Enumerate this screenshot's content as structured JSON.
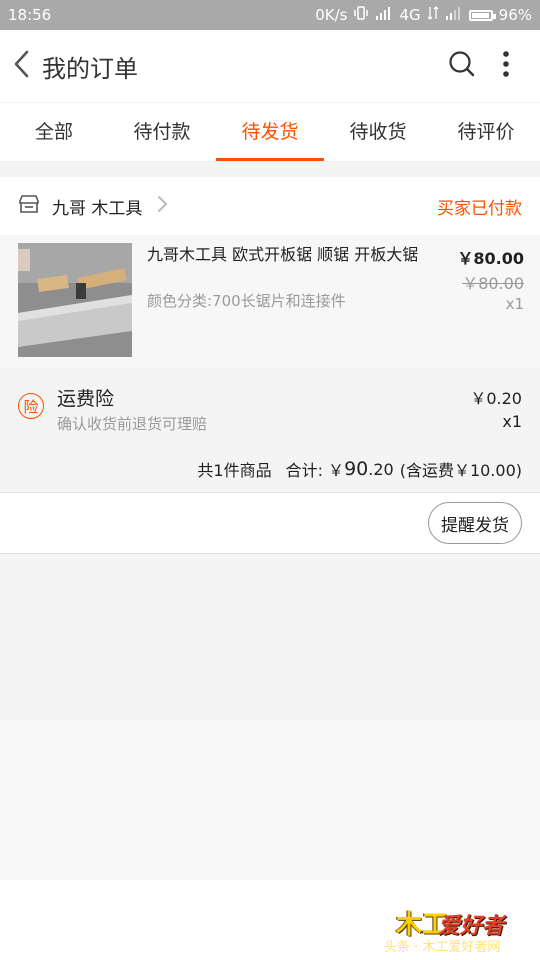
{
  "status_bar": {
    "time": "18:56",
    "net_speed": "0K/s",
    "network": "4G",
    "battery": "96%",
    "battery_level": 0.96
  },
  "header": {
    "title": "我的订单",
    "back_icon": "chevron-left-icon",
    "search_icon": "search-icon",
    "more_icon": "more-vertical-icon"
  },
  "tabs": [
    {
      "label": "全部",
      "active": false
    },
    {
      "label": "待付款",
      "active": false
    },
    {
      "label": "待发货",
      "active": true
    },
    {
      "label": "待收货",
      "active": false
    },
    {
      "label": "待评价",
      "active": false
    }
  ],
  "order": {
    "shop_name": "九哥 木工具",
    "status": "买家已付款",
    "product": {
      "name": "九哥木工具 欧式开板锯 顺锯 开板大锯",
      "sku": "颜色分类:700长锯片和连接件",
      "price": "￥80.00",
      "original_price": "￥80.00",
      "qty": "x1"
    },
    "insurance": {
      "icon_text": "险",
      "name": "运费险",
      "desc": "确认收货前退货可理赔",
      "price": "￥0.20",
      "qty": "x1"
    },
    "summary": {
      "count": "共1件商品",
      "total_label": "合计: ￥",
      "total_int": "90",
      "total_dec": ".20",
      "shipping": "(含运费￥10.00)"
    },
    "action_label": "提醒发货"
  },
  "watermark": {
    "logo_left": "木工",
    "logo_right": "爱好者",
    "sub": "头条 · 木工爱好者网"
  },
  "colors": {
    "accent": "#ff5000",
    "status_bar": "#a9a9a9"
  }
}
